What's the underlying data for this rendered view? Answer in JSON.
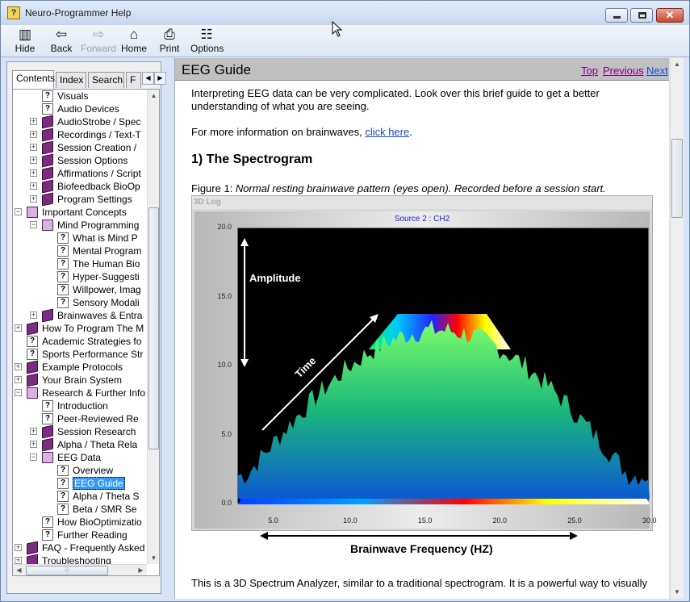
{
  "window": {
    "title": "Neuro-Programmer Help"
  },
  "toolbar": {
    "hide": "Hide",
    "back": "Back",
    "forward": "Forward",
    "home": "Home",
    "print": "Print",
    "options": "Options"
  },
  "nav_tabs": [
    "Contents",
    "Index",
    "Search",
    "F"
  ],
  "tree": [
    {
      "label": "Visuals",
      "type": "page"
    },
    {
      "label": "Audio Devices",
      "type": "page"
    },
    {
      "label": "AudioStrobe / Spec",
      "type": "book"
    },
    {
      "label": "Recordings / Text-T",
      "type": "book"
    },
    {
      "label": "Session Creation /",
      "type": "book"
    },
    {
      "label": "Session Options",
      "type": "book"
    },
    {
      "label": "Affirmations / Script",
      "type": "book"
    },
    {
      "label": "Biofeedback BioOp",
      "type": "book"
    },
    {
      "label": "Program Settings",
      "type": "book"
    },
    {
      "label": "Important Concepts",
      "type": "book-open"
    },
    {
      "label": "Mind Programming",
      "type": "book-open"
    },
    {
      "label": "What is Mind P",
      "type": "page"
    },
    {
      "label": "Mental Program",
      "type": "page"
    },
    {
      "label": "The Human Bio",
      "type": "page"
    },
    {
      "label": "Hyper-Suggesti",
      "type": "page"
    },
    {
      "label": "Willpower, Imag",
      "type": "page"
    },
    {
      "label": "Sensory Modali",
      "type": "page"
    },
    {
      "label": "Brainwaves & Entra",
      "type": "book"
    },
    {
      "label": "How To Program The M",
      "type": "book"
    },
    {
      "label": "Academic Strategies fo",
      "type": "page"
    },
    {
      "label": "Sports Performance Str",
      "type": "page"
    },
    {
      "label": "Example Protocols",
      "type": "book"
    },
    {
      "label": "Your Brain System",
      "type": "book"
    },
    {
      "label": "Research & Further Info",
      "type": "book-open"
    },
    {
      "label": "Introduction",
      "type": "page"
    },
    {
      "label": "Peer-Reviewed Re",
      "type": "page"
    },
    {
      "label": "Session Research",
      "type": "book"
    },
    {
      "label": "Alpha / Theta Rela",
      "type": "book"
    },
    {
      "label": "EEG Data",
      "type": "book-open"
    },
    {
      "label": "Overview",
      "type": "page"
    },
    {
      "label": "EEG Guide",
      "type": "page",
      "selected": true
    },
    {
      "label": "Alpha / Theta S",
      "type": "page"
    },
    {
      "label": "Beta / SMR Se",
      "type": "page"
    },
    {
      "label": "How BioOptimizatio",
      "type": "page"
    },
    {
      "label": "Further Reading",
      "type": "page"
    },
    {
      "label": "FAQ - Frequently Asked",
      "type": "book"
    },
    {
      "label": "Troubleshooting",
      "type": "book"
    }
  ],
  "topic": {
    "title": "EEG Guide",
    "nav_top": "Top",
    "nav_previous": "Previous",
    "nav_next": "Next",
    "intro_line1": "Interpreting EEG data can be very complicated. Look over this brief guide to get a better",
    "intro_line2": "understanding of what you are seeing.",
    "more_info": "For more information on brainwaves, ",
    "click_here": "click here",
    "more_info_end": ".",
    "section": "1) The Spectrogram",
    "figure_label": "Figure 1: ",
    "figure_caption": "Normal resting brainwave pattern (eyes open). Recorded before a session start.",
    "bottom_line": "This is a 3D Spectrum Analyzer, similar to a traditional spectrogram. It is a powerful way to visually"
  },
  "plot": {
    "header": "3D Log",
    "source": "Source 2 : CH2",
    "amplitude_label": "Amplitude",
    "time_label": "Time",
    "x_caption": "Brainwave Frequency (HZ)"
  },
  "chart_data": {
    "type": "area",
    "title": "",
    "ylim": [
      0,
      20
    ],
    "xlim": [
      2.5,
      30
    ],
    "y_ticks": [
      "20.0",
      "15.0",
      "10.0",
      "5.0",
      "0.0"
    ],
    "x_ticks": [
      "5.0",
      "10.0",
      "15.0",
      "20.0",
      "25.0",
      "30.0"
    ]
  },
  "colors": {
    "link": "#1a4cc7",
    "visited_link": "#800080",
    "selected": "#3399ff"
  }
}
